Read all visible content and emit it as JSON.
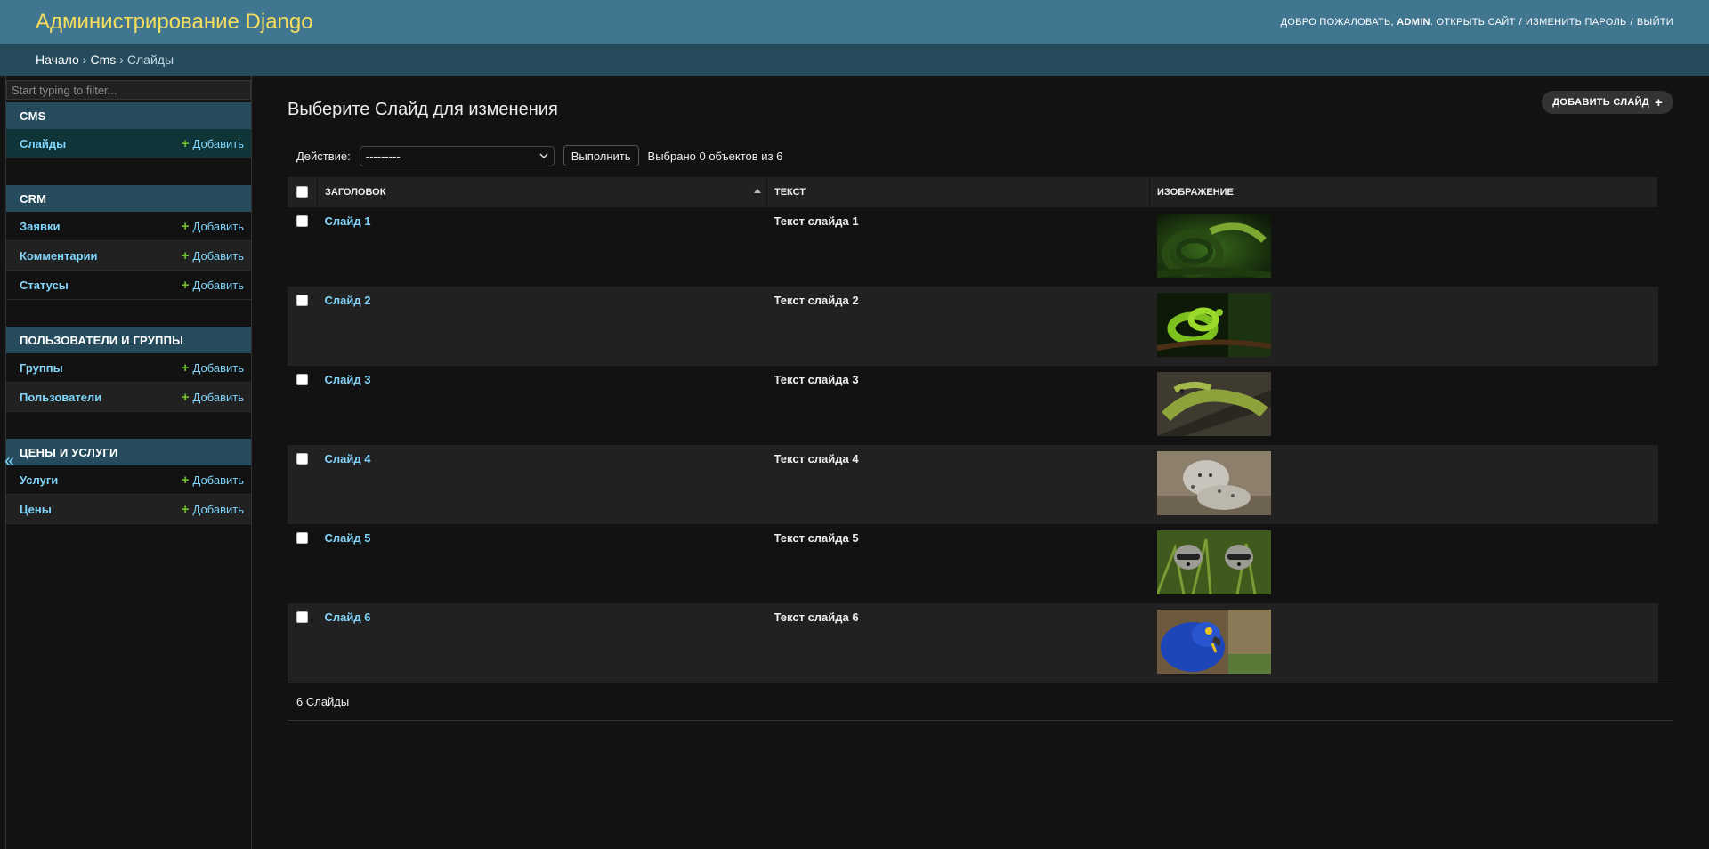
{
  "header": {
    "branding": "Администрирование Django",
    "welcome": "Добро пожаловать,",
    "username": "admin",
    "view_site": "Открыть сайт",
    "change_password": "Изменить пароль",
    "logout": "Выйти"
  },
  "breadcrumbs": {
    "home": "Начало",
    "app": "Cms",
    "current": "Слайды"
  },
  "sidebar": {
    "toggle_label": "«",
    "filter_placeholder": "Start typing to filter...",
    "add_label": "Добавить",
    "apps": [
      {
        "caption": "CMS",
        "models": [
          {
            "name": "Слайды",
            "current": true
          }
        ]
      },
      {
        "caption": "CRM",
        "models": [
          {
            "name": "Заявки"
          },
          {
            "name": "Комментарии"
          },
          {
            "name": "Статусы"
          }
        ]
      },
      {
        "caption": "Пользователи и группы",
        "models": [
          {
            "name": "Группы"
          },
          {
            "name": "Пользователи"
          }
        ]
      },
      {
        "caption": "Цены и услуги",
        "models": [
          {
            "name": "Услуги"
          },
          {
            "name": "Цены"
          }
        ]
      }
    ]
  },
  "content": {
    "title": "Выберите Слайд для изменения",
    "add_button": "Добавить Слайд",
    "actions": {
      "label": "Действие:",
      "selected_value": "---------",
      "go_button": "Выполнить",
      "counter": "Выбрано 0 объектов из 6"
    },
    "table": {
      "columns": [
        "Заголовок",
        "Текст",
        "Изображение"
      ],
      "rows": [
        {
          "title": "Слайд 1",
          "text": "Текст слайда 1",
          "image": "green-snake"
        },
        {
          "title": "Слайд 2",
          "text": "Текст слайда 2",
          "image": "green-python"
        },
        {
          "title": "Слайд 3",
          "text": "Текст слайда 3",
          "image": "iguana"
        },
        {
          "title": "Слайд 4",
          "text": "Текст слайда 4",
          "image": "snow-leopard"
        },
        {
          "title": "Слайд 5",
          "text": "Текст слайда 5",
          "image": "raccoons"
        },
        {
          "title": "Слайд 6",
          "text": "Текст слайда 6",
          "image": "blue-macaw"
        }
      ]
    },
    "paginator": "6 Слайды"
  },
  "colors": {
    "header_bg": "#417690",
    "breadcrumbs_bg": "#264b5d",
    "branding": "#f5dd5d",
    "link": "#81d4fa",
    "add_icon": "#70bf2b",
    "page_bg": "#121212"
  }
}
